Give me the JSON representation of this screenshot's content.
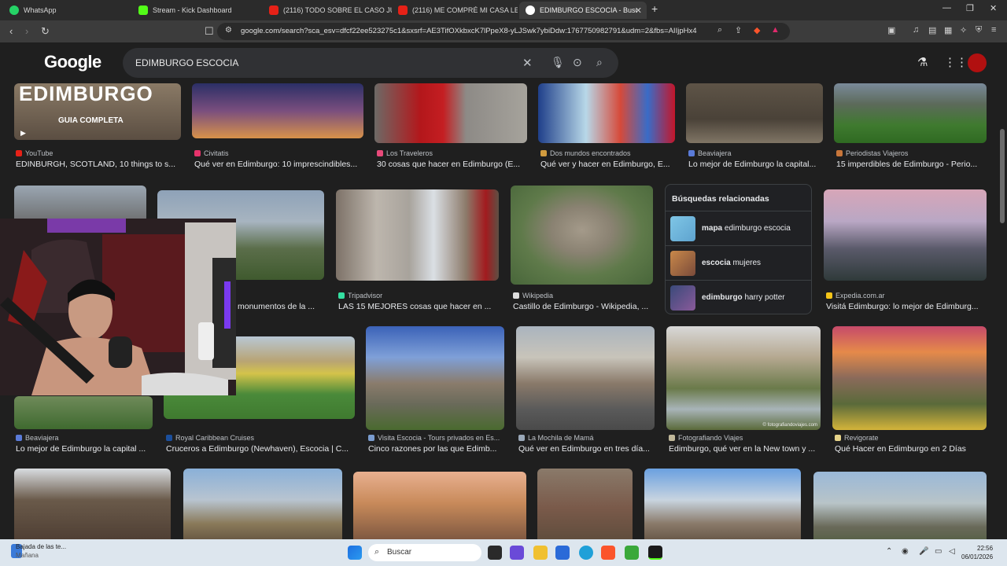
{
  "browser": {
    "tabs": [
      {
        "title": "WhatsApp",
        "active": false
      },
      {
        "title": "Stream - Kick Dashboard",
        "active": false
      },
      {
        "title": "(2116) TODO SOBRE EL CASO JUAN",
        "active": false
      },
      {
        "title": "(2116) ME COMPRÉ MI CASA LES M",
        "active": false
      },
      {
        "title": "EDIMBURGO ESCOCIA - Buscar c",
        "active": true
      }
    ],
    "new_tab_symbol": "+",
    "url": "google.com/search?sca_esv=dfcf22ee523275c1&sxsrf=AE3TifOXkbxcK7lPpeX8-yLJSwk7ybiDdw:1767750982791&udm=2&fbs=AIIjpHx4nJjfGoj..."
  },
  "google": {
    "logo": "Google",
    "query": "EDIMBURGO ESCOCIA"
  },
  "results": {
    "row1": [
      {
        "source": "YouTube",
        "title": "EDINBURGH, SCOTLAND, 10 things to s...",
        "overlay": "EDIMBURGO",
        "overlay2": "GUIA COMPLETA",
        "color": "#e62117"
      },
      {
        "source": "Civitatis",
        "title": "Qué ver en Edimburgo: 10 imprescindibles...",
        "color": "#e6336b"
      },
      {
        "source": "Los Traveleros",
        "title": "30 cosas que hacer en Edimburgo (E...",
        "color": "#e84a7a"
      },
      {
        "source": "Dos mundos encontrados",
        "title": "Qué ver y hacer en Edimburgo, E...",
        "color": "#d19b3e"
      },
      {
        "source": "Beaviajera",
        "title": "Lo mejor de Edimburgo la capital...",
        "color": "#5a7bd8"
      },
      {
        "source": "Periodistas Viajeros",
        "title": "15 imperdibles de Edimburgo - Perio...",
        "color": "#c8763a"
      }
    ],
    "row2": [
      {
        "source": "",
        "title": "",
        "color": "#888888"
      },
      {
        "source": "",
        "title": "monumentos de la ...",
        "color": "#888888"
      },
      {
        "source": "Tripadvisor",
        "title": "LAS 15 MEJORES cosas que hacer en ...",
        "color": "#34e0a1"
      },
      {
        "source": "Wikipedia",
        "title": "Castillo de Edimburgo - Wikipedia, ...",
        "color": "#dddddd"
      },
      {
        "source": "Expedia.com.ar",
        "title": "Visitá Edimburgo: lo mejor de Edimburg...",
        "color": "#f5c518"
      }
    ],
    "related": {
      "title": "Búsquedas relacionadas",
      "items": [
        {
          "pre": "mapa",
          "post": " edimburgo escocia"
        },
        {
          "pre": "escocia",
          "post": " mujeres"
        },
        {
          "pre": "edimburgo",
          "post": " harry potter"
        }
      ]
    },
    "row3": [
      {
        "source": "Beaviajera",
        "title": "Lo mejor de Edimburgo la capital ...",
        "color": "#5a7bd8"
      },
      {
        "source": "Royal Caribbean Cruises",
        "title": "Cruceros a Edimburgo (Newhaven), Escocia | C...",
        "color": "#1b4f9c"
      },
      {
        "source": "Visita Escocia - Tours privados en Es...",
        "title": "Cinco razones por las que Edimb...",
        "color": "#7a9ccf"
      },
      {
        "source": "La Mochila de Mamá",
        "title": "Qué ver en Edimburgo en tres día...",
        "color": "#9aa8b8"
      },
      {
        "source": "Fotografiando Viajes",
        "title": "Edimburgo, qué ver en la New town y ...",
        "color": "#c0b89a"
      },
      {
        "source": "Revigorate",
        "title": "Qué Hacer en Edimburgo en 2 Días",
        "color": "#e6d48a"
      }
    ],
    "photo_credit": "© fotografiandoviajes.com"
  },
  "taskbar": {
    "weather_line1": "Bajada de las te...",
    "weather_line2": "Mañana",
    "search_placeholder": "Buscar",
    "time": "22:56",
    "date": "06/01/2026"
  }
}
